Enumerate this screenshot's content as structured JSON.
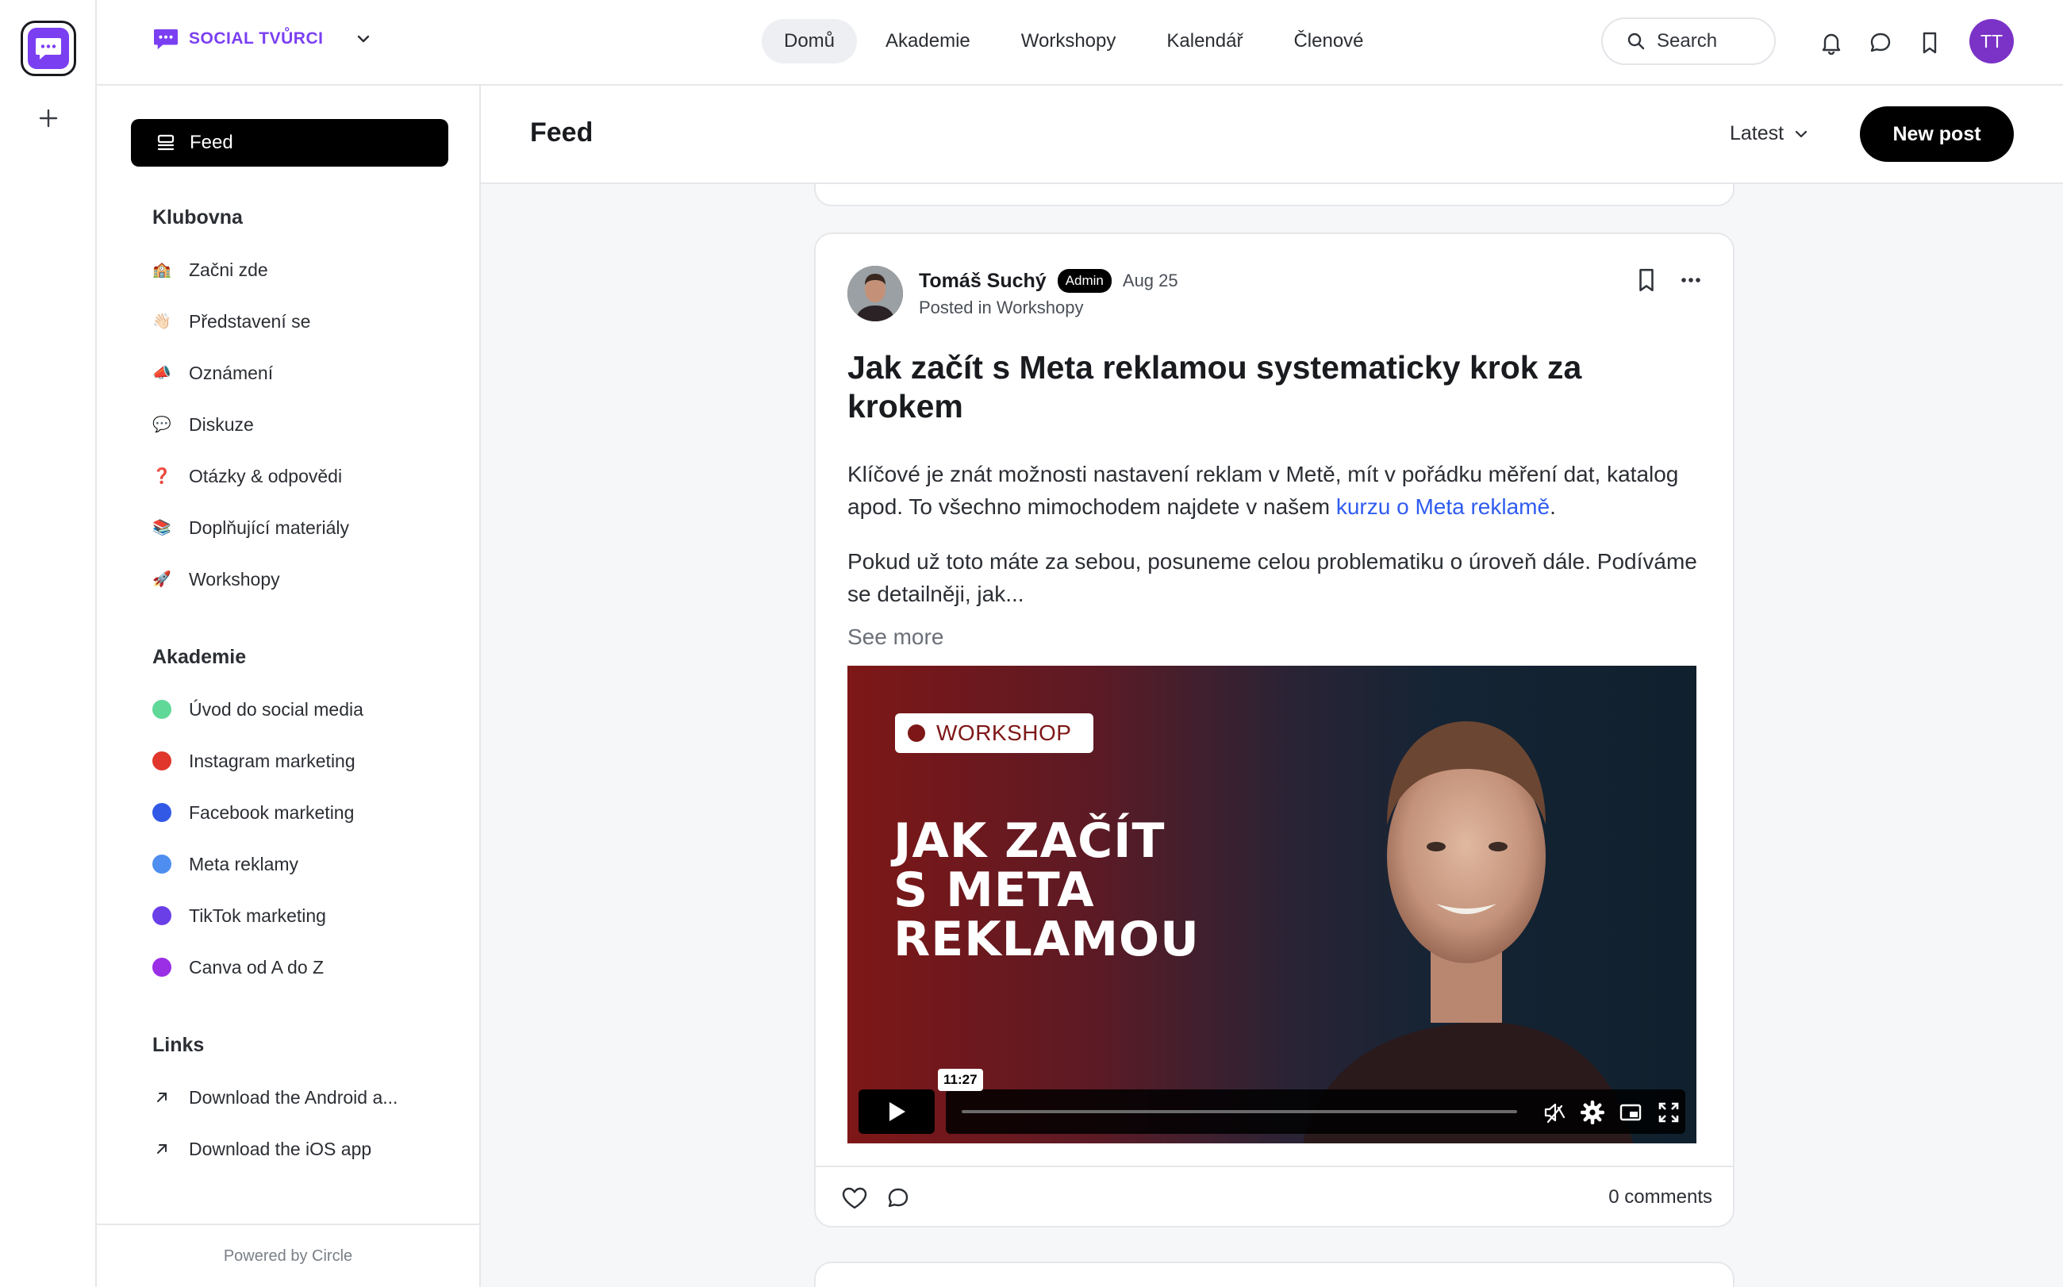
{
  "brand": {
    "name": "SOCIAL TVŮRCI",
    "accent": "#7b3ff2"
  },
  "nav": [
    {
      "label": "Domů",
      "active": true
    },
    {
      "label": "Akademie"
    },
    {
      "label": "Workshopy"
    },
    {
      "label": "Kalendář"
    },
    {
      "label": "Členové"
    }
  ],
  "search": {
    "label": "Search"
  },
  "user": {
    "initials": "TT"
  },
  "sidebar": {
    "feed_label": "Feed",
    "sections": [
      {
        "title": "Klubovna",
        "items": [
          {
            "label": "Začni zde",
            "emoji": "🏫"
          },
          {
            "label": "Představení se",
            "emoji": "👋🏻"
          },
          {
            "label": "Oznámení",
            "emoji": "📣"
          },
          {
            "label": "Diskuze",
            "emoji": "💬"
          },
          {
            "label": "Otázky & odpovědi",
            "emoji": "❓"
          },
          {
            "label": "Doplňující materiály",
            "emoji": "📚"
          },
          {
            "label": "Workshopy",
            "emoji": "🚀"
          }
        ]
      },
      {
        "title": "Akademie",
        "items": [
          {
            "label": "Úvod do social media",
            "color": "#5fd898"
          },
          {
            "label": "Instagram marketing",
            "color": "#e0362c"
          },
          {
            "label": "Facebook marketing",
            "color": "#3259e6"
          },
          {
            "label": "Meta reklamy",
            "color": "#4e8ef0"
          },
          {
            "label": "TikTok marketing",
            "color": "#6b3fe8"
          },
          {
            "label": "Canva od A do Z",
            "color": "#9a2fe6"
          }
        ]
      },
      {
        "title": "Links",
        "items": [
          {
            "label": "Download the Android a..."
          },
          {
            "label": "Download the iOS app"
          }
        ]
      }
    ],
    "powered_by": "Powered by Circle"
  },
  "main": {
    "title": "Feed",
    "sort_label": "Latest",
    "new_post_label": "New post"
  },
  "post": {
    "author": "Tomáš Suchý",
    "badge": "Admin",
    "date": "Aug 25",
    "posted_in": "Posted in Workshopy",
    "title": "Jak začít s Meta reklamou systematicky krok za krokem",
    "body1_text": "Klíčové je znát možnosti nastavení reklam v Metě, mít v pořádku měření dat, katalog apod. To všechno mimochodem najdete v našem ",
    "body1_link": "kurzu o Meta reklamě",
    "body1_end": ".",
    "body2": "Pokud už toto máte za sebou, posuneme celou problematiku o úroveň dále. Podíváme se detailněji, jak...",
    "see_more": "See more",
    "video": {
      "badge": "WORKSHOP",
      "title_lines": [
        "JAK ZAČÍT",
        "S META",
        "REKLAMOU"
      ],
      "duration": "11:27"
    },
    "comments": "0 comments"
  }
}
